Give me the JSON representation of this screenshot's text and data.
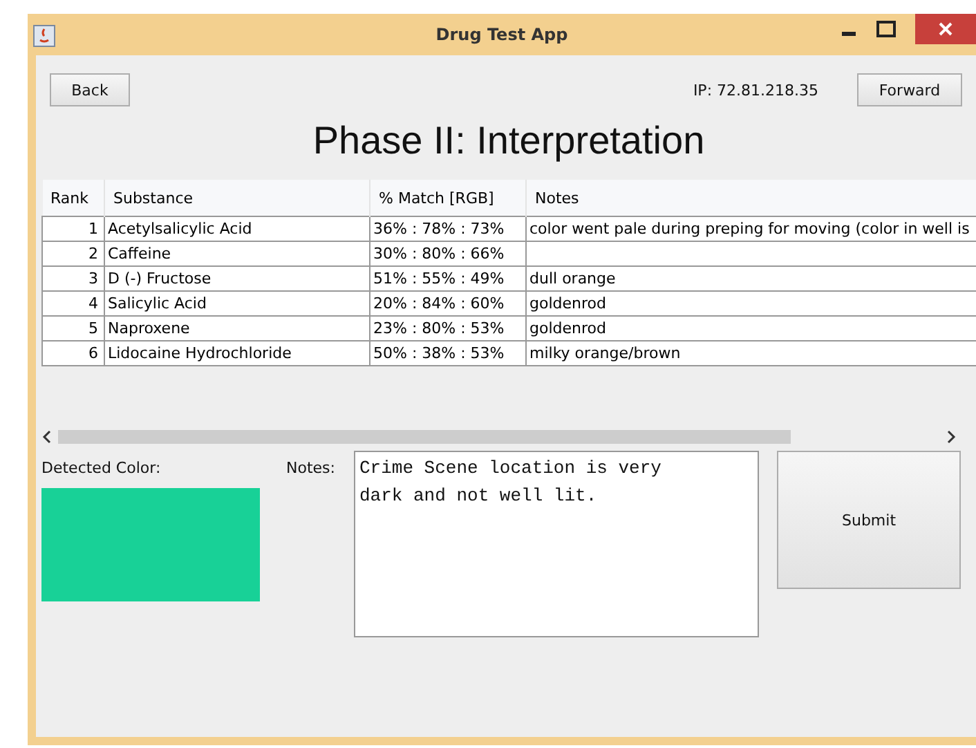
{
  "window": {
    "title": "Drug Test App"
  },
  "toolbar": {
    "back": "Back",
    "ip": "IP: 72.81.218.35",
    "forward": "Forward"
  },
  "heading": "Phase II: Interpretation",
  "table": {
    "columns": [
      "Rank",
      "Substance",
      "% Match [RGB]",
      "Notes"
    ],
    "rows": [
      {
        "rank": "1",
        "substance": "Acetylsalicylic Acid",
        "match": "36% : 78% : 73%",
        "notes": "color went pale during preping for moving (color in well is"
      },
      {
        "rank": "2",
        "substance": "Caffeine",
        "match": "30% : 80% : 66%",
        "notes": ""
      },
      {
        "rank": "3",
        "substance": "D (-) Fructose",
        "match": "51% : 55% : 49%",
        "notes": "dull orange"
      },
      {
        "rank": "4",
        "substance": "Salicylic Acid",
        "match": "20% : 84% : 60%",
        "notes": "goldenrod"
      },
      {
        "rank": "5",
        "substance": "Naproxene",
        "match": "23% : 80% : 53%",
        "notes": "goldenrod"
      },
      {
        "rank": "6",
        "substance": "Lidocaine Hydrochloride",
        "match": "50% : 38% : 53%",
        "notes": "milky orange/brown"
      }
    ]
  },
  "detected_color": {
    "label": "Detected Color:",
    "color": "#18d197"
  },
  "notes": {
    "label": "Notes:",
    "value": "Crime Scene location is very dark and not well lit."
  },
  "submit": "Submit"
}
